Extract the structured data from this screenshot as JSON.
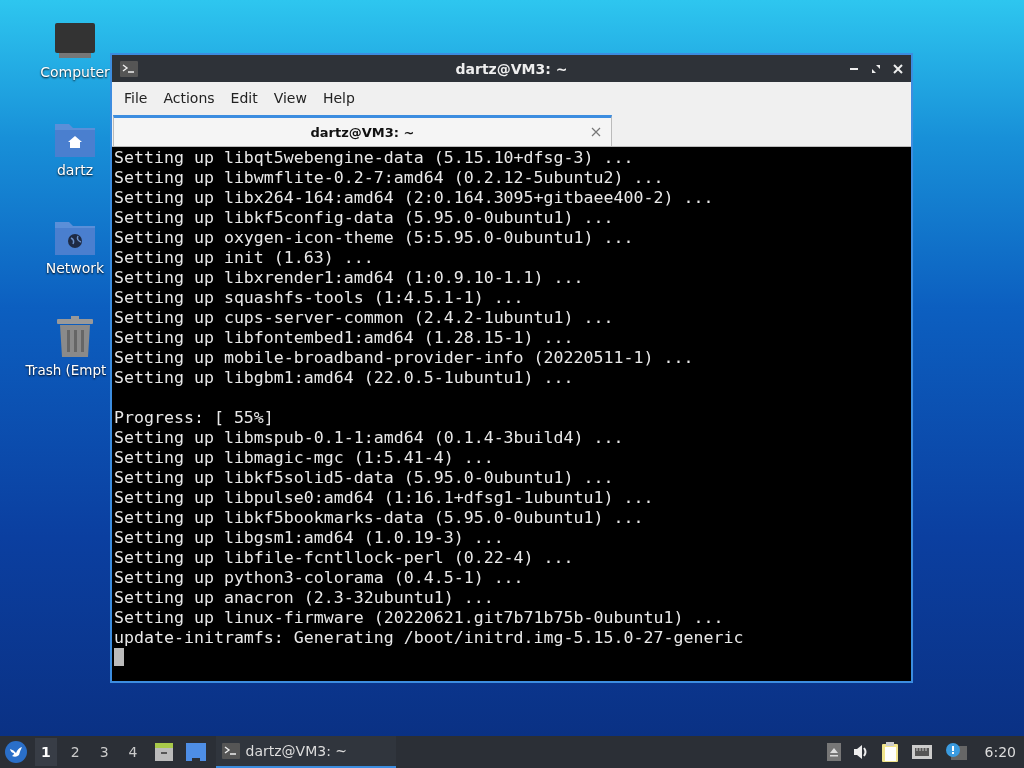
{
  "desktop_icons": [
    {
      "label": "Computer",
      "kind": "computer"
    },
    {
      "label": "dartz",
      "kind": "home"
    },
    {
      "label": "Network",
      "kind": "network"
    },
    {
      "label": "Trash (Empt",
      "kind": "trash"
    }
  ],
  "window": {
    "title": "dartz@VM3: ~",
    "menu": [
      "File",
      "Actions",
      "Edit",
      "View",
      "Help"
    ],
    "tabs": [
      {
        "label": "dartz@VM3: ~",
        "selected": true
      }
    ],
    "terminal": {
      "blocks": [
        [
          "Setting up libqt5webengine-data (5.15.10+dfsg-3) ...",
          "Setting up libwmflite-0.2-7:amd64 (0.2.12-5ubuntu2) ...",
          "Setting up libx264-164:amd64 (2:0.164.3095+gitbaee400-2) ...",
          "Setting up libkf5config-data (5.95.0-0ubuntu1) ...",
          "Setting up oxygen-icon-theme (5:5.95.0-0ubuntu1) ...",
          "Setting up init (1.63) ...",
          "Setting up libxrender1:amd64 (1:0.9.10-1.1) ...",
          "Setting up squashfs-tools (1:4.5.1-1) ...",
          "Setting up cups-server-common (2.4.2-1ubuntu1) ...",
          "Setting up libfontembed1:amd64 (1.28.15-1) ...",
          "Setting up mobile-broadband-provider-info (20220511-1) ...",
          "Setting up libgbm1:amd64 (22.0.5-1ubuntu1) ..."
        ],
        [
          "Progress: [ 55%]",
          "Setting up libmspub-0.1-1:amd64 (0.1.4-3build4) ...",
          "Setting up libmagic-mgc (1:5.41-4) ...",
          "Setting up libkf5solid5-data (5.95.0-0ubuntu1) ...",
          "Setting up libpulse0:amd64 (1:16.1+dfsg1-1ubuntu1) ...",
          "Setting up libkf5bookmarks-data (5.95.0-0ubuntu1) ...",
          "Setting up libgsm1:amd64 (1.0.19-3) ...",
          "Setting up libfile-fcntllock-perl (0.22-4) ...",
          "Setting up python3-colorama (0.4.5-1) ...",
          "Setting up anacron (2.3-32ubuntu1) ...",
          "Setting up linux-firmware (20220621.git7b71b75b-0ubuntu1) ...",
          "update-initramfs: Generating /boot/initrd.img-5.15.0-27-generic"
        ]
      ]
    }
  },
  "taskbar": {
    "workspaces": [
      {
        "label": "1",
        "selected": true
      },
      {
        "label": "2",
        "selected": false
      },
      {
        "label": "3",
        "selected": false
      },
      {
        "label": "4",
        "selected": false
      }
    ],
    "tasks": [
      {
        "label": "dartz@VM3: ~",
        "selected": true
      }
    ],
    "clock": "6:20"
  }
}
